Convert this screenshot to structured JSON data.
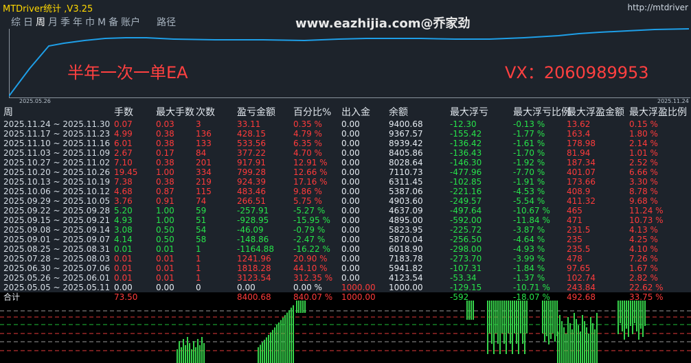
{
  "window": {
    "title": "MTDriver统计 ,V3.25",
    "url": "http://mtdriver"
  },
  "period_tabs": [
    {
      "label": "综",
      "active": false
    },
    {
      "label": "日",
      "active": false
    },
    {
      "label": "周",
      "active": true
    },
    {
      "label": "月",
      "active": false
    },
    {
      "label": "季",
      "active": false
    },
    {
      "label": "年",
      "active": false
    },
    {
      "label": "巾",
      "active": false
    },
    {
      "label": "M",
      "active": false
    },
    {
      "label": "备",
      "active": false
    },
    {
      "label": "账户",
      "active": false
    },
    {
      "label": "路径",
      "active": false
    }
  ],
  "watermark": "www.eazhijia.com@乔家劲",
  "equity_chart": {
    "start_date": "2025.05.26",
    "end_date": "2025.11.24",
    "line_color": "#1e9fe8"
  },
  "promo": {
    "left": "半年一次一单EA",
    "right": "VX：2060989953"
  },
  "colors": {
    "panel_bg": "#1d232b",
    "positive": "#27e34a",
    "negative": "#ff3b3b",
    "title": "#ffd700"
  },
  "table": {
    "headers": [
      "周",
      "手数",
      "最大手数",
      "次数",
      "盈亏金额",
      "百分比%",
      "出入金",
      "余额",
      "最大浮亏",
      "最大浮亏比例",
      "最大浮盈金额",
      "最大浮盈比例"
    ],
    "rows": [
      [
        "2025.11.24 ~ 2025.11.30",
        "0.07",
        "0.03",
        "3",
        "33.11",
        "0.35 %",
        "0.00",
        "9400.68",
        "-12.30",
        "-0.13 %",
        "13.62",
        "0.15 %"
      ],
      [
        "2025.11.17 ~ 2025.11.23",
        "4.99",
        "0.38",
        "136",
        "428.15",
        "4.79 %",
        "0.00",
        "9367.57",
        "-155.42",
        "-1.77 %",
        "163.4",
        "1.80 %"
      ],
      [
        "2025.11.10 ~ 2025.11.16",
        "6.01",
        "0.38",
        "133",
        "533.56",
        "6.35 %",
        "0.00",
        "8939.42",
        "-136.42",
        "-1.61 %",
        "178.98",
        "2.14 %"
      ],
      [
        "2025.11.03 ~ 2025.11.09",
        "2.67",
        "0.17",
        "84",
        "377.22",
        "4.70 %",
        "0.00",
        "8405.86",
        "-136.43",
        "-1.70 %",
        "81.94",
        "1.01 %"
      ],
      [
        "2025.10.27 ~ 2025.11.02",
        "7.10",
        "0.38",
        "201",
        "917.91",
        "12.91 %",
        "0.00",
        "8028.64",
        "-146.30",
        "-1.92 %",
        "187.34",
        "2.52 %"
      ],
      [
        "2025.10.20 ~ 2025.10.26",
        "19.45",
        "1.00",
        "334",
        "799.28",
        "12.66 %",
        "0.00",
        "7110.73",
        "-477.96",
        "-7.70 %",
        "401.07",
        "6.66 %"
      ],
      [
        "2025.10.13 ~ 2025.10.19",
        "7.38",
        "0.38",
        "219",
        "924.39",
        "17.16 %",
        "0.00",
        "6311.45",
        "-102.85",
        "-1.91 %",
        "173.66",
        "3.30 %"
      ],
      [
        "2025.10.06 ~ 2025.10.12",
        "4.68",
        "0.87",
        "115",
        "483.46",
        "9.86 %",
        "0.00",
        "5387.06",
        "-221.16",
        "-4.53 %",
        "408.9",
        "8.78 %"
      ],
      [
        "2025.09.29 ~ 2025.10.05",
        "3.76",
        "0.91",
        "74",
        "266.51",
        "5.75 %",
        "0.00",
        "4903.60",
        "-249.57",
        "-5.54 %",
        "411.32",
        "9.68 %"
      ],
      [
        "2025.09.22 ~ 2025.09.28",
        "5.20",
        "1.00",
        "59",
        "-257.91",
        "-5.27 %",
        "0.00",
        "4637.09",
        "-497.64",
        "-10.67 %",
        "465",
        "11.24 %"
      ],
      [
        "2025.09.15 ~ 2025.09.21",
        "4.93",
        "1.00",
        "51",
        "-928.95",
        "-15.95 %",
        "0.00",
        "4895.00",
        "-592.00",
        "-11.84 %",
        "471",
        "10.73 %"
      ],
      [
        "2025.09.08 ~ 2025.09.14",
        "3.08",
        "0.50",
        "54",
        "-46.09",
        "-0.79 %",
        "0.00",
        "5823.95",
        "-225.72",
        "-3.87 %",
        "231.5",
        "4.13 %"
      ],
      [
        "2025.09.01 ~ 2025.09.07",
        "4.14",
        "0.50",
        "58",
        "-148.86",
        "-2.47 %",
        "0.00",
        "5870.04",
        "-256.50",
        "-4.64 %",
        "235",
        "4.25 %"
      ],
      [
        "2025.08.25 ~ 2025.08.31",
        "0.01",
        "0.01",
        "1",
        "-1164.88",
        "-16.22 %",
        "0.00",
        "6018.90",
        "-298.00",
        "-4.93 %",
        "235.5",
        "4.10 %"
      ],
      [
        "2025.07.28 ~ 2025.08.03",
        "0.01",
        "0.01",
        "1",
        "1241.96",
        "20.90 %",
        "0.00",
        "7183.78",
        "-273.70",
        "-3.99 %",
        "478",
        "7.26 %"
      ],
      [
        "2025.06.30 ~ 2025.07.06",
        "0.01",
        "0.01",
        "1",
        "1818.28",
        "44.10 %",
        "0.00",
        "5941.82",
        "-107.31",
        "-1.84 %",
        "97.65",
        "1.67 %"
      ],
      [
        "2025.05.26 ~ 2025.06.01",
        "0.01",
        "0.01",
        "1",
        "3123.54",
        "312.35 %",
        "0.00",
        "4123.54",
        "-53.34",
        "-1.37 %",
        "102.74",
        "2.82 %"
      ],
      [
        "2025.05.05 ~ 2025.05.11",
        "0.00",
        "0.00",
        "0",
        "0.00",
        "0.00 %",
        "1000.00",
        "1000.00",
        "-129.15",
        "-10.71 %",
        "243.84",
        "22.62 %"
      ]
    ],
    "total": [
      "合计",
      "73.50",
      "",
      "",
      "8400.68",
      "840.07 %",
      "1000.00",
      "",
      "-592",
      "-18.07 %",
      "492.68",
      "33.75 %"
    ]
  }
}
